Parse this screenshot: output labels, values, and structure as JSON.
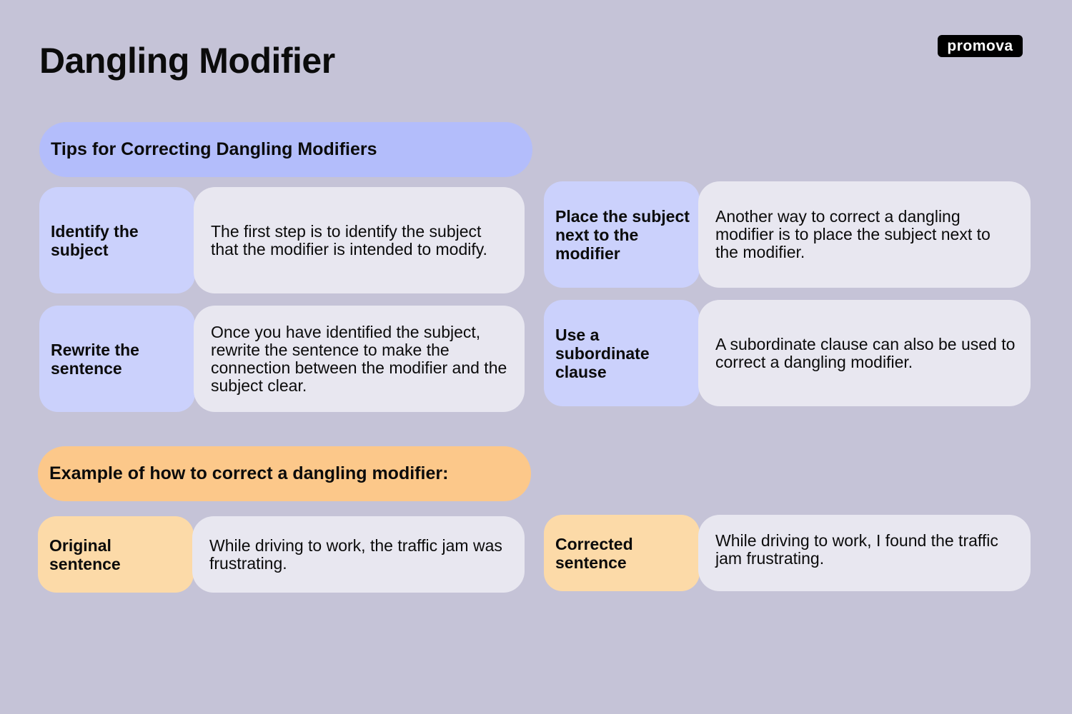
{
  "header": {
    "title": "Dangling Modifier",
    "logo": "promova"
  },
  "tips": {
    "heading": "Tips for Correcting Dangling Modifiers",
    "items": [
      {
        "label": "Identify the subject",
        "description": "The first step is to identify the subject that the modifier is intended to modify."
      },
      {
        "label": "Rewrite the sentence",
        "description": "Once you have identified the subject, rewrite the sentence to make the connection between the modifier and the subject clear."
      },
      {
        "label": "Place the subject next to the modifier",
        "description": "Another way to correct a dangling modifier is to place the subject next to the modifier."
      },
      {
        "label": "Use a subordinate clause",
        "description": "A subordinate clause can also be used to correct a dangling modifier."
      }
    ]
  },
  "example": {
    "heading": "Example of how to correct a dangling modifier:",
    "items": [
      {
        "label": "Original sentence",
        "description": "While driving to work, the traffic jam was frustrating."
      },
      {
        "label": "Corrected sentence",
        "description": "While driving to work, I found the traffic jam frustrating."
      }
    ]
  },
  "colors": {
    "background": "#c5c3d7",
    "tips_heading": "#b3bdfb",
    "tips_label": "#cbd1fc",
    "example_heading": "#fcc88a",
    "example_label": "#fcdaa8",
    "description_bg": "#e8e7f0"
  }
}
